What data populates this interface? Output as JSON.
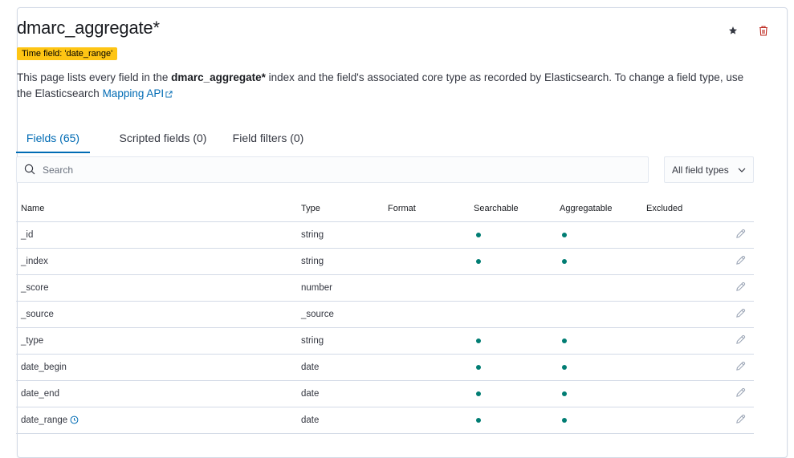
{
  "header": {
    "title": "dmarc_aggregate*",
    "time_field_badge": "Time field: 'date_range'",
    "description_part1": "This page lists every field in the ",
    "description_index": "dmarc_aggregate*",
    "description_part2": " index and the field's associated core type as recorded by Elasticsearch. To change a field type, use the Elasticsearch ",
    "mapping_link": "Mapping API",
    "star_icon": "star-icon",
    "delete_icon": "trash-icon"
  },
  "tabs": [
    {
      "label": "Fields (65)",
      "active": true
    },
    {
      "label": "Scripted fields (0)",
      "active": false
    },
    {
      "label": "Field filters (0)",
      "active": false
    }
  ],
  "search": {
    "placeholder": "Search"
  },
  "filter_select": {
    "value": "All field types"
  },
  "table": {
    "columns": [
      "Name",
      "Type",
      "Format",
      "Searchable",
      "Aggregatable",
      "Excluded"
    ],
    "rows": [
      {
        "name": "_id",
        "type": "string",
        "format": "",
        "searchable": true,
        "aggregatable": true,
        "excluded": false
      },
      {
        "name": "_index",
        "type": "string",
        "format": "",
        "searchable": true,
        "aggregatable": true,
        "excluded": false
      },
      {
        "name": "_score",
        "type": "number",
        "format": "",
        "searchable": false,
        "aggregatable": false,
        "excluded": false
      },
      {
        "name": "_source",
        "type": "_source",
        "format": "",
        "searchable": false,
        "aggregatable": false,
        "excluded": false
      },
      {
        "name": "_type",
        "type": "string",
        "format": "",
        "searchable": true,
        "aggregatable": true,
        "excluded": false
      },
      {
        "name": "date_begin",
        "type": "date",
        "format": "",
        "searchable": true,
        "aggregatable": true,
        "excluded": false
      },
      {
        "name": "date_end",
        "type": "date",
        "format": "",
        "searchable": true,
        "aggregatable": true,
        "excluded": false
      },
      {
        "name": "date_range",
        "type": "date",
        "format": "",
        "searchable": true,
        "aggregatable": true,
        "excluded": false,
        "time_field": true
      }
    ]
  },
  "colors": {
    "accent": "#006bb4",
    "dot": "#017d73",
    "badge": "#fec514",
    "danger": "#bd271e"
  }
}
